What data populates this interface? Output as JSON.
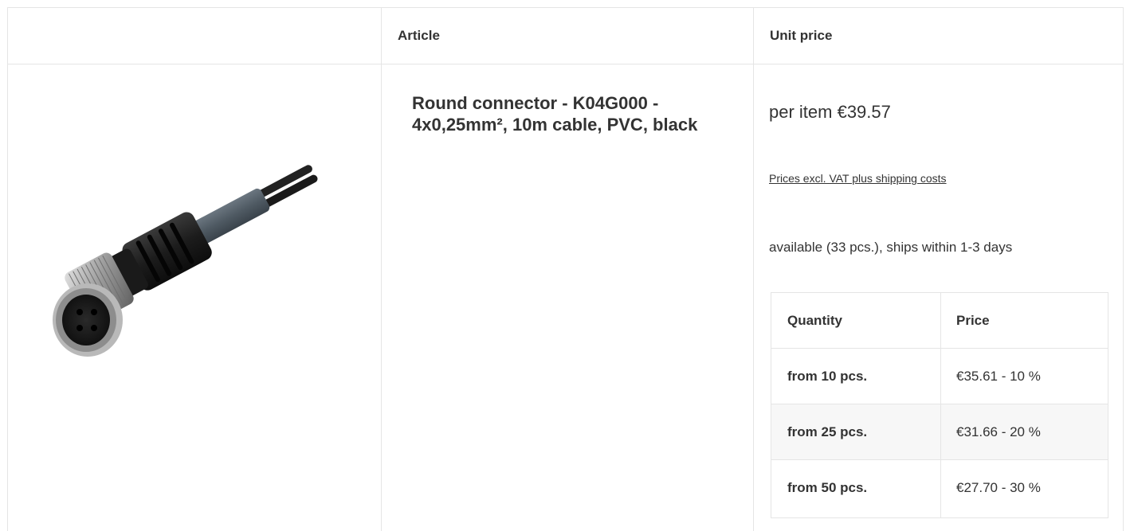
{
  "table": {
    "headers": {
      "image": "",
      "article": "Article",
      "unit_price": "Unit price"
    }
  },
  "product": {
    "title": "Round connector - K04G000 - 4x0,25mm², 10m cable, PVC, black",
    "image_icon": "round-connector-product-image",
    "price": "per item €39.57",
    "vat_link": "Prices excl. VAT plus shipping costs",
    "availability": "available (33 pcs.), ships within 1-3 days"
  },
  "tiers": {
    "headers": [
      "Quantity",
      "Price"
    ],
    "rows": [
      {
        "quantity": "from 10 pcs.",
        "price": "€35.61 - 10 %"
      },
      {
        "quantity": "from 25 pcs.",
        "price": "€31.66 - 20 %"
      },
      {
        "quantity": "from 50 pcs.",
        "price": "€27.70 - 30 %"
      }
    ]
  },
  "colors": {
    "border": "#e5e5e5",
    "text": "#333333",
    "alt_row": "#f7f7f7"
  }
}
